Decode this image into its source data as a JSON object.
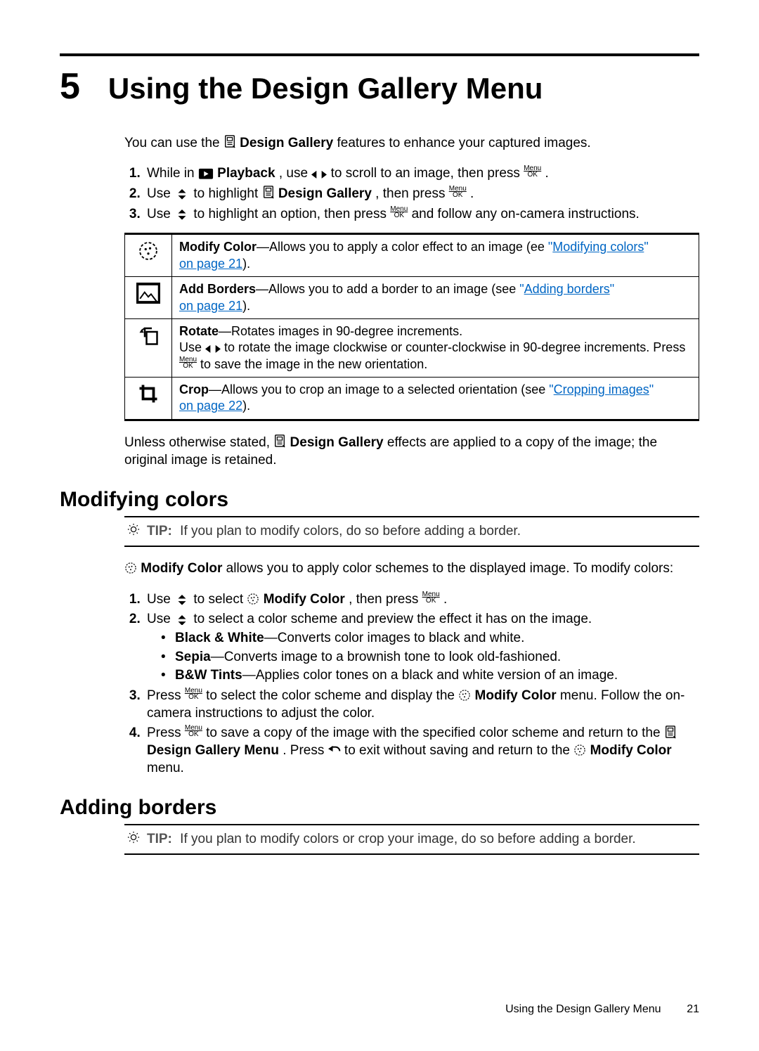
{
  "chapter": {
    "number": "5",
    "title": "Using the Design Gallery Menu"
  },
  "intro": {
    "pre": "You can use the ",
    "bold": " Design Gallery",
    "post": " features to enhance your captured images."
  },
  "steps_top": {
    "s1": {
      "a": "While in ",
      "b": " Playback",
      "c": ", use ",
      "d": " to scroll to an image, then press ",
      "e": "."
    },
    "s2": {
      "a": "Use ",
      "b": " to highlight ",
      "c": " Design Gallery",
      "d": ", then press ",
      "e": "."
    },
    "s3": {
      "a": "Use ",
      "b": " to highlight an option, then press ",
      "c": " and follow any on-camera instructions."
    }
  },
  "table": {
    "r1": {
      "head": "Modify Color",
      "dash": "—",
      "text": "Allows you to apply a color effect to an image (ee ",
      "q1": "\"",
      "link": "Modifying colors",
      "q2": "\"",
      "tail": "on page 21",
      "end": ")."
    },
    "r2": {
      "head": "Add Borders",
      "dash": "—",
      "text": "Allows you to add a border to an image (see ",
      "q1": "\"",
      "link": "Adding borders",
      "q2": "\"",
      "tail": "on page 21",
      "end": ")."
    },
    "r3": {
      "head": "Rotate",
      "dash": "—",
      "text": "Rotates images in 90-degree increments.",
      "l2a": "Use ",
      "l2b": " to rotate the image clockwise or counter-clockwise in 90-degree increments. Press ",
      "l2c": " to save the image in the new orientation."
    },
    "r4": {
      "head": "Crop",
      "dash": "—",
      "text": "Allows you to crop an image to a selected orientation (see ",
      "q1": "\"",
      "link": "Cropping images",
      "q2": "\"",
      "tail": "on page 22",
      "end": ")."
    }
  },
  "note_after_table": {
    "a": "Unless otherwise stated, ",
    "b": " Design Gallery",
    "c": " effects are applied to a copy of the image; the original image is retained."
  },
  "sec_modify": {
    "heading": "Modifying colors",
    "tip_label": "TIP:",
    "tip_text": "If you plan to modify colors, do so before adding a border.",
    "p1a": " Modify Color",
    "p1b": " allows you to apply color schemes to the displayed image. To modify colors:",
    "s1": {
      "a": "Use ",
      "b": " to select ",
      "c": " Modify Color",
      "d": ", then press ",
      "e": "."
    },
    "s2": {
      "a": "Use ",
      "b": " to select a color scheme and preview the effect it has on the image."
    },
    "b1": {
      "h": "Black & White",
      "t": "—Converts color images to black and white."
    },
    "b2": {
      "h": "Sepia",
      "t": "—Converts image to a brownish tone to look old-fashioned."
    },
    "b3": {
      "h": "B&W Tints",
      "t": "—Applies color tones on a black and white version of an image."
    },
    "s3": {
      "a": "Press ",
      "b": " to select the color scheme and display the ",
      "c": " Modify Color",
      "d": " menu. Follow the on-camera instructions to adjust the color."
    },
    "s4": {
      "a": "Press ",
      "b": " to save a copy of the image with the specified color scheme and return to the ",
      "c": " Design Gallery Menu",
      "d": ". Press ",
      "e": " to exit without saving and return to the ",
      "f": " Modify Color",
      "g": " menu."
    }
  },
  "sec_borders": {
    "heading": "Adding borders",
    "tip_label": "TIP:",
    "tip_text": "If you plan to modify colors or crop your image, do so before adding a border."
  },
  "footer": {
    "text": "Using the Design Gallery Menu",
    "page": "21"
  },
  "menuok": {
    "top": "Menu",
    "bot": "OK"
  }
}
